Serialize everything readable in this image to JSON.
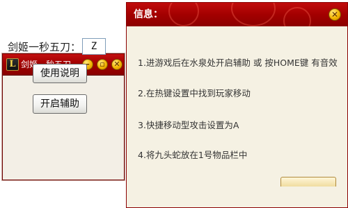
{
  "tool_window": {
    "title": "剑姬一秒五刀",
    "logo_letter": "L",
    "hotkey_label": "剑姬一秒五刀：",
    "hotkey_value": "Z",
    "help_button": "使用说明",
    "start_button": "开启辅助",
    "controls": {
      "minimize": "–",
      "maximize": "▫",
      "close": "✕"
    }
  },
  "info_window": {
    "title": "信息：",
    "close": "✕",
    "lines": [
      "1.进游戏后在水泉处开启辅助 或 按HOME键 有音效",
      "2.在热键设置中找到玩家移动",
      "3.快捷移动型攻击设置为A",
      "4.将九头蛇放在1号物品栏中"
    ]
  },
  "colors": {
    "titlebar_red": "#a30000",
    "window_bg": "#f5f1e3",
    "button_gold": "#f2b400"
  }
}
